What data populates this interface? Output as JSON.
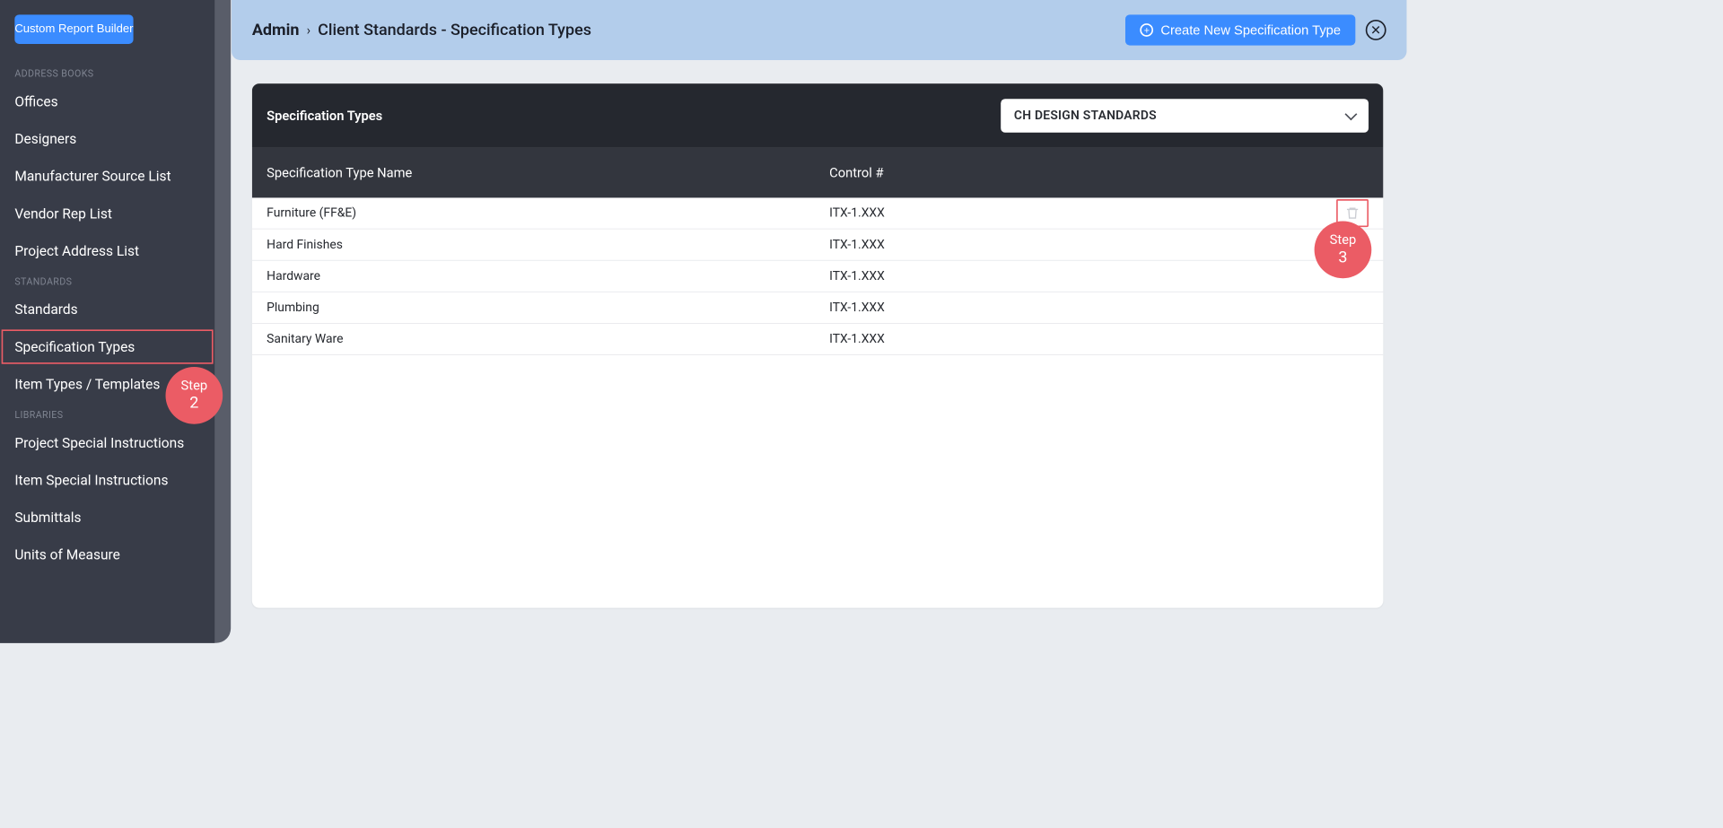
{
  "sidebar": {
    "custom_report_btn": "Custom Report Builder",
    "sections": [
      {
        "header": "ADDRESS BOOKS",
        "items": [
          {
            "label": "Offices"
          },
          {
            "label": "Designers"
          },
          {
            "label": "Manufacturer Source List"
          },
          {
            "label": "Vendor Rep List"
          },
          {
            "label": "Project Address List"
          }
        ]
      },
      {
        "header": "STANDARDS",
        "items": [
          {
            "label": "Standards"
          },
          {
            "label": "Specification Types",
            "active": true
          },
          {
            "label": "Item Types / Templates"
          }
        ]
      },
      {
        "header": "LIBRARIES",
        "items": [
          {
            "label": "Project Special Instructions"
          },
          {
            "label": "Item Special Instructions"
          },
          {
            "label": "Submittals"
          },
          {
            "label": "Units of Measure"
          }
        ]
      }
    ]
  },
  "header": {
    "crumb_root": "Admin",
    "crumb_page": "Client Standards - Specification Types",
    "create_btn": "Create New Specification Type"
  },
  "panel": {
    "title": "Specification Types",
    "dropdown_value": "CH DESIGN STANDARDS",
    "columns": {
      "name": "Specification Type Name",
      "control": "Control #"
    },
    "rows": [
      {
        "name": "Furniture (FF&E)",
        "control": "ITX-1.XXX",
        "trash": true
      },
      {
        "name": "Hard Finishes",
        "control": "ITX-1.XXX"
      },
      {
        "name": "Hardware",
        "control": "ITX-1.XXX"
      },
      {
        "name": "Plumbing",
        "control": "ITX-1.XXX"
      },
      {
        "name": "Sanitary Ware",
        "control": "ITX-1.XXX"
      }
    ]
  },
  "annotations": {
    "step_label": "Step",
    "step2": "2",
    "step3": "3"
  }
}
